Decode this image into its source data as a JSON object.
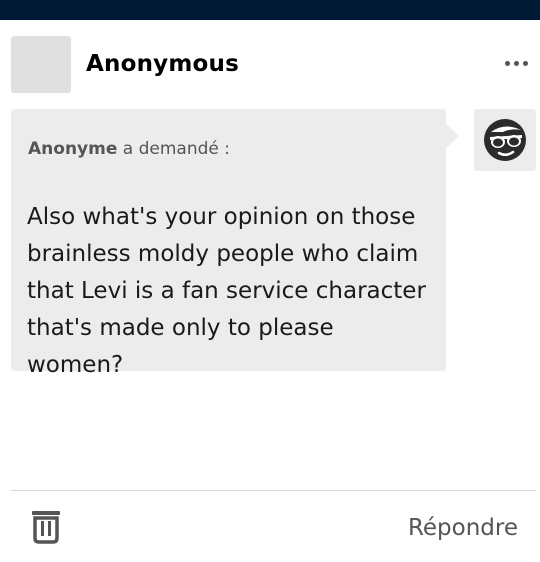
{
  "header": {
    "blog_name": "Anonymous",
    "more_icon": "more-horizontal-icon"
  },
  "ask": {
    "asker_name": "Anonyme",
    "asker_suffix": " a demandé :",
    "question": "Also what's your opinion on those brainless moldy people who claim that Levi is a fan service character that's made only to please women?",
    "asker_avatar_icon": "sunglasses-face-icon"
  },
  "footer": {
    "delete_icon": "trash-icon",
    "reply_label": "Répondre"
  },
  "colors": {
    "top_bar": "#001935",
    "bubble": "#ececec",
    "muted_text": "#555555"
  }
}
